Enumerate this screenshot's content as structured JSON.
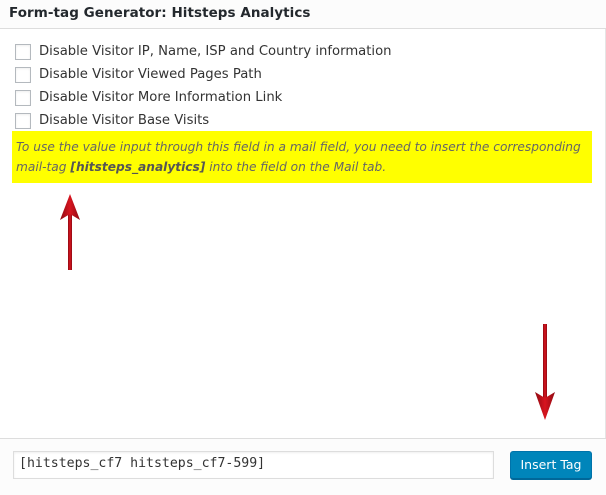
{
  "dialog": {
    "title": "Form-tag Generator: Hitsteps Analytics"
  },
  "options": [
    {
      "label": "Disable Visitor IP, Name, ISP and Country information",
      "checked": false
    },
    {
      "label": "Disable Visitor Viewed Pages Path",
      "checked": false
    },
    {
      "label": "Disable Visitor More Information Link",
      "checked": false
    },
    {
      "label": "Disable Visitor Base Visits",
      "checked": false
    }
  ],
  "notice": {
    "text_before": "To use the value input through this field in a mail field, you need to insert the corresponding mail-tag ",
    "tag": "[hitsteps_analytics]",
    "text_after": " into the field on the Mail tab.",
    "highlight_color": "#ffff00"
  },
  "footer": {
    "tag_value": "[hitsteps_cf7 hitsteps_cf7-599]",
    "insert_button_label": "Insert Tag"
  },
  "colors": {
    "arrow": "#c0111c",
    "button": "#0085ba"
  }
}
